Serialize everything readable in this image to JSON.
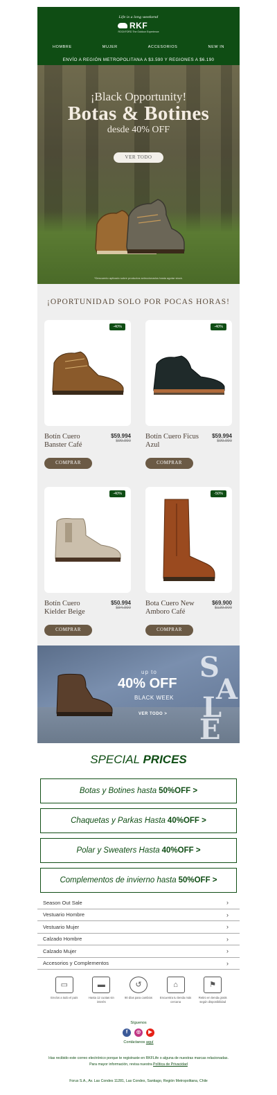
{
  "header": {
    "tagline": "Life is a long weekend",
    "brand": "RKF",
    "brand_sub": "ROCKFORD The Outdoor Experience",
    "nav": [
      "HOMBRE",
      "MUJER",
      "ACCESORIOS",
      "NEW IN"
    ],
    "shipping": "ENVÍO A REGIÓN METROPOLITANA A $3.590 Y REGIONES A $6.190"
  },
  "hero": {
    "subtitle": "¡Black Opportunity!",
    "title": "Botas & Botines",
    "from": "desde 40% OFF",
    "cta": "VER TODO",
    "note": "*Descuento aplicado sobre productos seleccionados hasta agotar stock."
  },
  "products": {
    "heading": "¡OPORTUNIDAD SOLO POR POCAS HORAS!",
    "items": [
      {
        "name": "Botín Cuero Banster Café",
        "price": "$59.994",
        "old": "$99.990",
        "badge": "-40%",
        "cta": "COMPRAR",
        "color": "#8a5a2b"
      },
      {
        "name": "Botín Cuero Ficus Azul",
        "price": "$59.994",
        "old": "$99.990",
        "badge": "-40%",
        "cta": "COMPRAR",
        "color": "#1f2a2a"
      },
      {
        "name": "Botín Cuero Kielder Beige",
        "price": "$50.994",
        "old": "$84.990",
        "badge": "-40%",
        "cta": "COMPRAR",
        "color": "#cbbfac"
      },
      {
        "name": "Bota Cuero New Amboro Café",
        "price": "$69.900",
        "old": "$139.900",
        "badge": "-50%",
        "cta": "COMPRAR",
        "color": "#9a4a1f"
      }
    ]
  },
  "sale": {
    "upto": "up to",
    "off": "40% OFF",
    "event": "BLACK WEEK",
    "cta": "VER TODO >",
    "letters": [
      "S",
      "A",
      "L",
      "E"
    ]
  },
  "special": {
    "title_light": "SPECIAL",
    "title_bold": "PRICES",
    "promos": [
      {
        "text": "Botas y Botines hasta",
        "bold": "50%OFF >"
      },
      {
        "text": "Chaquetas y Parkas Hasta",
        "bold": "40%OFF >"
      },
      {
        "text": "Polar y Sweaters Hasta",
        "bold": "40%OFF >"
      },
      {
        "text": "Complementos de invierno hasta",
        "bold": "50%OFF >"
      }
    ]
  },
  "categories": [
    "Season Out Sale",
    "Vestuario Hombre",
    "Vestuario Mujer",
    "Calzado Hombre",
    "Calzado Mujer",
    "Accesorios y Complementos"
  ],
  "benefits": [
    {
      "icon": "truck-icon",
      "text": "Envíos a todo el país"
    },
    {
      "icon": "credit-card-icon",
      "text": "Hasta 12 cuotas sin interés"
    },
    {
      "icon": "return-90-icon",
      "text": "90 días para cambios"
    },
    {
      "icon": "store-icon",
      "text": "Encuentra tu tienda más cercana"
    },
    {
      "icon": "pickup-bag-icon",
      "text": "Retiro en tienda gratis según disponibilidad"
    }
  ],
  "footer": {
    "follow": "Síguenos",
    "contact_prefix": "Contáctanos",
    "contact_link": "aquí",
    "legal_line1": "Has recibido este correo electrónico porque te registraste en RKFLife o alguna de nuestras marcas relacionadas.",
    "legal_line2_prefix": "Para mayor información, revisa nuestra",
    "legal_link": "Política de Privacidad",
    "address": "Forus S.A., Av. Las Condes 11281, Las Condes, Santiago, Región Metropolitana, Chile"
  },
  "colors": {
    "brand_green": "#0f4d14",
    "button_brown": "#6b5a45",
    "facebook": "#3b5998",
    "instagram": "#c13584",
    "youtube": "#e62117"
  }
}
